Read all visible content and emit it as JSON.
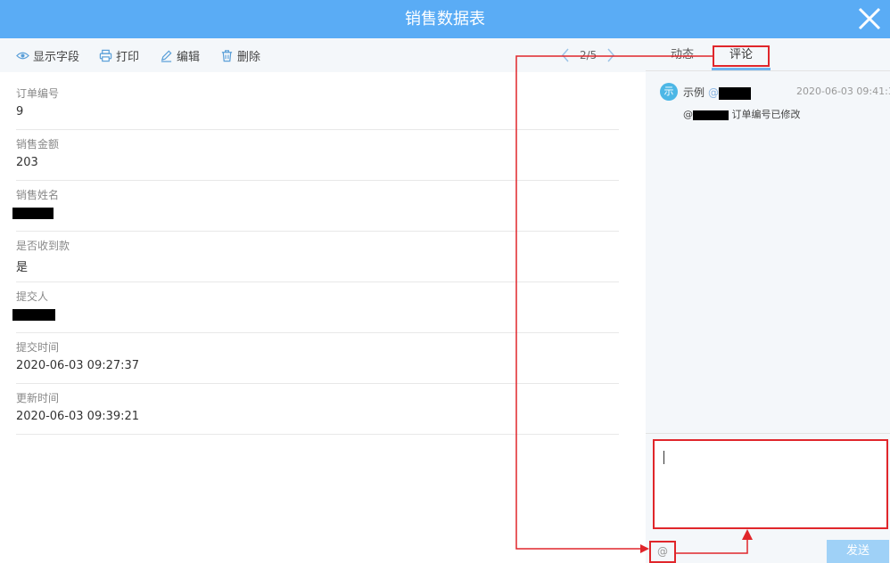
{
  "window": {
    "title": "销售数据表",
    "close_icon": "close-icon"
  },
  "toolbar": {
    "show_fields": "显示字段",
    "print": "打印",
    "edit": "编辑",
    "delete": "删除",
    "pager": "2/5"
  },
  "fields": [
    {
      "label": "订单编号",
      "value": "9"
    },
    {
      "label": "销售金额",
      "value": "203"
    },
    {
      "label": "销售姓名",
      "value": ""
    },
    {
      "label": "是否收到款",
      "value": "是"
    },
    {
      "label": "提交人",
      "value": ""
    },
    {
      "label": "提交时间",
      "value": "2020-06-03 09:27:37"
    },
    {
      "label": "更新时间",
      "value": "2020-06-03 09:39:21"
    }
  ],
  "tabs": {
    "activity": "动态",
    "comments": "评论"
  },
  "comment": {
    "avatar": "示",
    "author": "示例",
    "mention": "@",
    "time": "2020-06-03 09:41:39",
    "body_prefix": "@",
    "body_text": "订单编号已修改"
  },
  "composer": {
    "at_label": "@",
    "send_label": "发送"
  },
  "colors": {
    "header": "#5aacf5",
    "annotation": "#e0262b",
    "send": "#9fd1f7"
  }
}
